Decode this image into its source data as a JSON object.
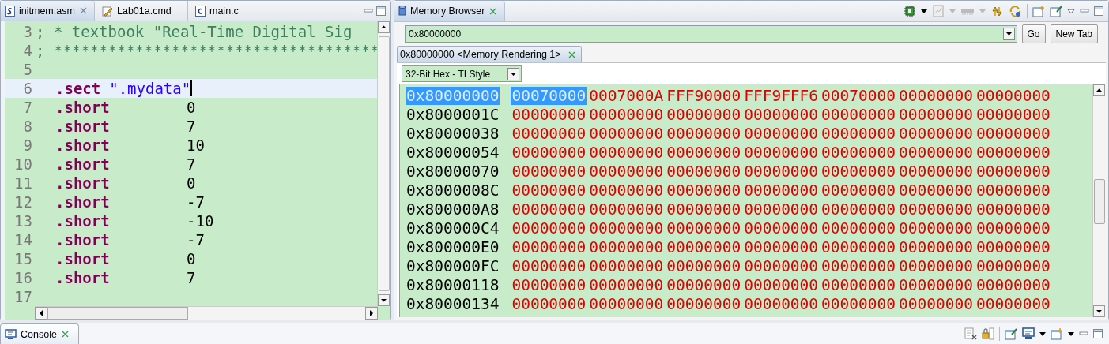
{
  "editor": {
    "tabs": [
      {
        "label": "initmem.asm",
        "kind": "asm",
        "selected": true
      },
      {
        "label": "Lab01a.cmd",
        "kind": "cmd",
        "selected": false
      },
      {
        "label": "main.c",
        "kind": "c",
        "selected": false
      }
    ],
    "lines": [
      {
        "number": "3",
        "kind": "comment",
        "text": "; * textbook \"Real-Time Digital Sig",
        "current": false
      },
      {
        "number": "4",
        "kind": "comment",
        "text": "; ************************************",
        "current": false
      },
      {
        "number": "5",
        "kind": "blank",
        "current": false
      },
      {
        "number": "6",
        "kind": "section",
        "directive": ".sect",
        "operand": "\".mydata\"",
        "current": true
      },
      {
        "number": "7",
        "kind": "data",
        "directive": ".short",
        "operand": "0",
        "current": false
      },
      {
        "number": "8",
        "kind": "data",
        "directive": ".short",
        "operand": "7",
        "current": false
      },
      {
        "number": "9",
        "kind": "data",
        "directive": ".short",
        "operand": "10",
        "current": false
      },
      {
        "number": "10",
        "kind": "data",
        "directive": ".short",
        "operand": "7",
        "current": false
      },
      {
        "number": "11",
        "kind": "data",
        "directive": ".short",
        "operand": "0",
        "current": false
      },
      {
        "number": "12",
        "kind": "data",
        "directive": ".short",
        "operand": "-7",
        "current": false
      },
      {
        "number": "13",
        "kind": "data",
        "directive": ".short",
        "operand": "-10",
        "current": false
      },
      {
        "number": "14",
        "kind": "data",
        "directive": ".short",
        "operand": "-7",
        "current": false
      },
      {
        "number": "15",
        "kind": "data",
        "directive": ".short",
        "operand": "0",
        "current": false
      },
      {
        "number": "16",
        "kind": "data",
        "directive": ".short",
        "operand": "7",
        "current": false
      },
      {
        "number": "17",
        "kind": "blank",
        "current": false
      }
    ]
  },
  "memory_browser": {
    "tab": {
      "label": "Memory Browser",
      "selected": true
    },
    "address_field": {
      "value": "0x80000000"
    },
    "buttons": [
      "Go",
      "New Tab"
    ],
    "rendering_tab": {
      "label": "0x80000000 <Memory Rendering 1>",
      "selected": true
    },
    "format": {
      "value": "32-Bit Hex - TI Style"
    },
    "rows": [
      {
        "address": "0x80000000",
        "selected": true,
        "words": [
          {
            "value": "00070000",
            "selected": true
          },
          {
            "value": "0007000A",
            "selected": false
          },
          {
            "value": "FFF90000",
            "selected": false
          },
          {
            "value": "FFF9FFF6",
            "selected": false
          },
          {
            "value": "00070000",
            "selected": false
          },
          {
            "value": "00000000",
            "selected": false
          },
          {
            "value": "00000000",
            "selected": false
          }
        ]
      },
      {
        "address": "0x8000001C",
        "selected": false,
        "words": [
          {
            "value": "00000000",
            "selected": false
          },
          {
            "value": "00000000",
            "selected": false
          },
          {
            "value": "00000000",
            "selected": false
          },
          {
            "value": "00000000",
            "selected": false
          },
          {
            "value": "00000000",
            "selected": false
          },
          {
            "value": "00000000",
            "selected": false
          },
          {
            "value": "00000000",
            "selected": false
          }
        ]
      },
      {
        "address": "0x80000038",
        "selected": false,
        "words": [
          {
            "value": "00000000",
            "selected": false
          },
          {
            "value": "00000000",
            "selected": false
          },
          {
            "value": "00000000",
            "selected": false
          },
          {
            "value": "00000000",
            "selected": false
          },
          {
            "value": "00000000",
            "selected": false
          },
          {
            "value": "00000000",
            "selected": false
          },
          {
            "value": "00000000",
            "selected": false
          }
        ]
      },
      {
        "address": "0x80000054",
        "selected": false,
        "words": [
          {
            "value": "00000000",
            "selected": false
          },
          {
            "value": "00000000",
            "selected": false
          },
          {
            "value": "00000000",
            "selected": false
          },
          {
            "value": "00000000",
            "selected": false
          },
          {
            "value": "00000000",
            "selected": false
          },
          {
            "value": "00000000",
            "selected": false
          },
          {
            "value": "00000000",
            "selected": false
          }
        ]
      },
      {
        "address": "0x80000070",
        "selected": false,
        "words": [
          {
            "value": "00000000",
            "selected": false
          },
          {
            "value": "00000000",
            "selected": false
          },
          {
            "value": "00000000",
            "selected": false
          },
          {
            "value": "00000000",
            "selected": false
          },
          {
            "value": "00000000",
            "selected": false
          },
          {
            "value": "00000000",
            "selected": false
          },
          {
            "value": "00000000",
            "selected": false
          }
        ]
      },
      {
        "address": "0x8000008C",
        "selected": false,
        "words": [
          {
            "value": "00000000",
            "selected": false
          },
          {
            "value": "00000000",
            "selected": false
          },
          {
            "value": "00000000",
            "selected": false
          },
          {
            "value": "00000000",
            "selected": false
          },
          {
            "value": "00000000",
            "selected": false
          },
          {
            "value": "00000000",
            "selected": false
          },
          {
            "value": "00000000",
            "selected": false
          }
        ]
      },
      {
        "address": "0x800000A8",
        "selected": false,
        "words": [
          {
            "value": "00000000",
            "selected": false
          },
          {
            "value": "00000000",
            "selected": false
          },
          {
            "value": "00000000",
            "selected": false
          },
          {
            "value": "00000000",
            "selected": false
          },
          {
            "value": "00000000",
            "selected": false
          },
          {
            "value": "00000000",
            "selected": false
          },
          {
            "value": "00000000",
            "selected": false
          }
        ]
      },
      {
        "address": "0x800000C4",
        "selected": false,
        "words": [
          {
            "value": "00000000",
            "selected": false
          },
          {
            "value": "00000000",
            "selected": false
          },
          {
            "value": "00000000",
            "selected": false
          },
          {
            "value": "00000000",
            "selected": false
          },
          {
            "value": "00000000",
            "selected": false
          },
          {
            "value": "00000000",
            "selected": false
          },
          {
            "value": "00000000",
            "selected": false
          }
        ]
      },
      {
        "address": "0x800000E0",
        "selected": false,
        "words": [
          {
            "value": "00000000",
            "selected": false
          },
          {
            "value": "00000000",
            "selected": false
          },
          {
            "value": "00000000",
            "selected": false
          },
          {
            "value": "00000000",
            "selected": false
          },
          {
            "value": "00000000",
            "selected": false
          },
          {
            "value": "00000000",
            "selected": false
          },
          {
            "value": "00000000",
            "selected": false
          }
        ]
      },
      {
        "address": "0x800000FC",
        "selected": false,
        "words": [
          {
            "value": "00000000",
            "selected": false
          },
          {
            "value": "00000000",
            "selected": false
          },
          {
            "value": "00000000",
            "selected": false
          },
          {
            "value": "00000000",
            "selected": false
          },
          {
            "value": "00000000",
            "selected": false
          },
          {
            "value": "00000000",
            "selected": false
          },
          {
            "value": "00000000",
            "selected": false
          }
        ]
      },
      {
        "address": "0x80000118",
        "selected": false,
        "words": [
          {
            "value": "00000000",
            "selected": false
          },
          {
            "value": "00000000",
            "selected": false
          },
          {
            "value": "00000000",
            "selected": false
          },
          {
            "value": "00000000",
            "selected": false
          },
          {
            "value": "00000000",
            "selected": false
          },
          {
            "value": "00000000",
            "selected": false
          },
          {
            "value": "00000000",
            "selected": false
          }
        ]
      },
      {
        "address": "0x80000134",
        "selected": false,
        "words": [
          {
            "value": "00000000",
            "selected": false
          },
          {
            "value": "00000000",
            "selected": false
          },
          {
            "value": "00000000",
            "selected": false
          },
          {
            "value": "00000000",
            "selected": false
          },
          {
            "value": "00000000",
            "selected": false
          },
          {
            "value": "00000000",
            "selected": false
          },
          {
            "value": "00000000",
            "selected": false
          }
        ]
      }
    ]
  },
  "console": {
    "tab": {
      "label": "Console",
      "selected": true
    }
  }
}
